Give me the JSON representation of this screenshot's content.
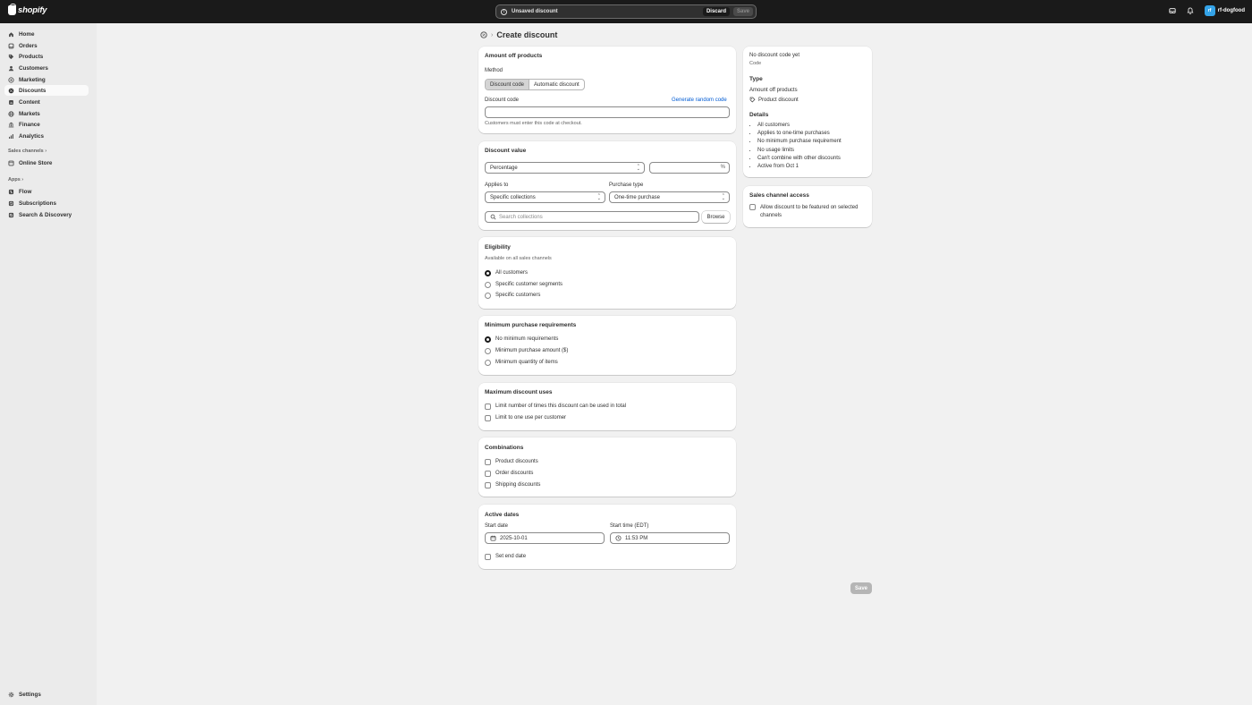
{
  "topbar": {
    "brand": "shopify",
    "savebar_message": "Unsaved discount",
    "discard_label": "Discard",
    "save_label": "Save",
    "store_initials": "rf",
    "store_name": "rf-dogfood"
  },
  "sidebar": {
    "items": [
      {
        "label": "Home",
        "icon": "home-icon"
      },
      {
        "label": "Orders",
        "icon": "orders-icon"
      },
      {
        "label": "Products",
        "icon": "tag-icon"
      },
      {
        "label": "Customers",
        "icon": "person-icon"
      },
      {
        "label": "Marketing",
        "icon": "target-icon"
      },
      {
        "label": "Discounts",
        "icon": "discount-icon"
      },
      {
        "label": "Content",
        "icon": "content-icon"
      },
      {
        "label": "Markets",
        "icon": "globe-icon"
      },
      {
        "label": "Finance",
        "icon": "bank-icon"
      },
      {
        "label": "Analytics",
        "icon": "chart-icon"
      }
    ],
    "active": "Discounts",
    "sales_channels_label": "Sales channels",
    "sales_channels": [
      {
        "label": "Online Store",
        "icon": "store-icon"
      }
    ],
    "apps_label": "Apps",
    "apps": [
      {
        "label": "Flow",
        "icon": "flow-icon"
      },
      {
        "label": "Subscriptions",
        "icon": "subscriptions-icon"
      },
      {
        "label": "Search & Discovery",
        "icon": "search-discovery-icon"
      }
    ],
    "settings_label": "Settings"
  },
  "page": {
    "title": "Create discount"
  },
  "amount_card": {
    "title": "Amount off products",
    "method_label": "Method",
    "method_options": [
      "Discount code",
      "Automatic discount"
    ],
    "discount_code_label": "Discount code",
    "generate_link": "Generate random code",
    "code_value": "",
    "help": "Customers must enter this code at checkout."
  },
  "value_card": {
    "title": "Discount value",
    "type_value": "Percentage",
    "amount_value": "",
    "suffix": "%",
    "applies_to_label": "Applies to",
    "applies_to_value": "Specific collections",
    "purchase_type_label": "Purchase type",
    "purchase_type_value": "One-time purchase",
    "search_placeholder": "Search collections",
    "browse_label": "Browse"
  },
  "eligibility_card": {
    "title": "Eligibility",
    "subtitle": "Available on all sales channels",
    "options": [
      "All customers",
      "Specific customer segments",
      "Specific customers"
    ],
    "selected": "All customers"
  },
  "min_card": {
    "title": "Minimum purchase requirements",
    "options": [
      "No minimum requirements",
      "Minimum purchase amount ($)",
      "Minimum quantity of items"
    ],
    "selected": "No minimum requirements"
  },
  "max_card": {
    "title": "Maximum discount uses",
    "options": [
      "Limit number of times this discount can be used in total",
      "Limit to one use per customer"
    ]
  },
  "combo_card": {
    "title": "Combinations",
    "options": [
      "Product discounts",
      "Order discounts",
      "Shipping discounts"
    ]
  },
  "dates_card": {
    "title": "Active dates",
    "start_date_label": "Start date",
    "start_date_value": "2025-10-01",
    "start_time_label": "Start time (EDT)",
    "start_time_value": "11:53 PM",
    "end_date_label": "Set end date"
  },
  "summary": {
    "code_title": "No discount code yet",
    "code_sub": "Code",
    "type_heading": "Type",
    "type_value": "Amount off products",
    "type_sub": "Product discount",
    "details_heading": "Details",
    "details": [
      "All customers",
      "Applies to one-time purchases",
      "No minimum purchase requirement",
      "No usage limits",
      "Can't combine with other discounts",
      "Active from Oct 1"
    ]
  },
  "channel_card": {
    "title": "Sales channel access",
    "checkbox_label": "Allow discount to be featured on selected channels"
  },
  "footer": {
    "save_label": "Save"
  }
}
